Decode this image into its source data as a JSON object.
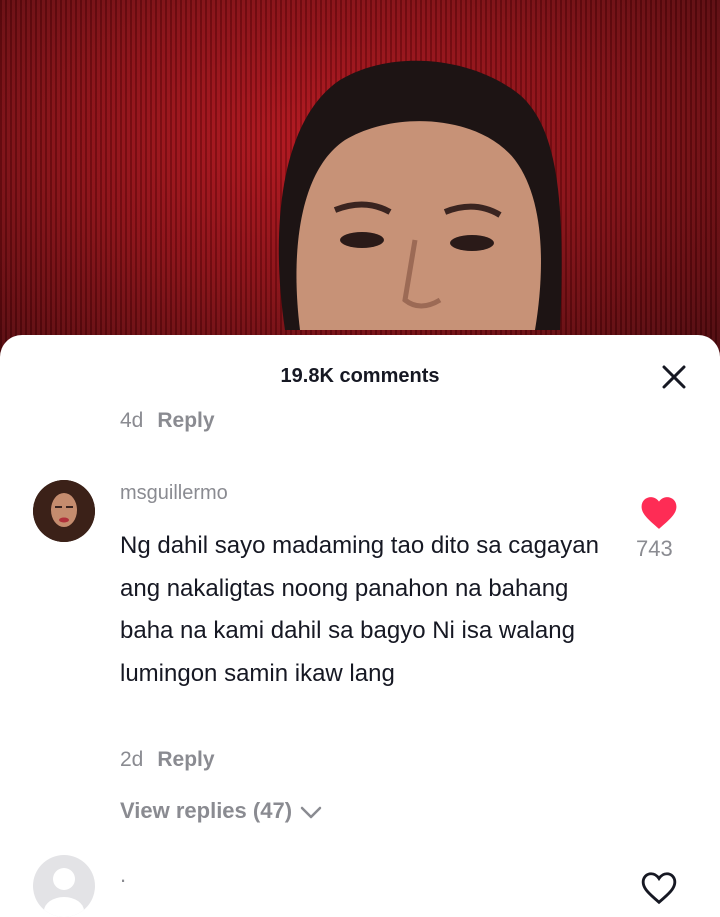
{
  "video": {
    "background_color": "#9e1218"
  },
  "comments_sheet": {
    "title": "19.8K comments",
    "close_icon": "close-icon",
    "previous_comment_meta": {
      "time": "4d",
      "reply_label": "Reply"
    },
    "comment": {
      "username": "msguillermo",
      "text": "Ng dahil sayo madaming tao dito sa cagayan ang nakaligtas noong panahon na bahang baha na kami dahil sa bagyo Ni isa walang lumingon samin ikaw lang",
      "time": "2d",
      "reply_label": "Reply",
      "like_count": "743",
      "liked": true,
      "like_color": "#fe2c55",
      "view_replies_label": "View replies (47)"
    },
    "next_comment": {
      "text": "."
    }
  }
}
